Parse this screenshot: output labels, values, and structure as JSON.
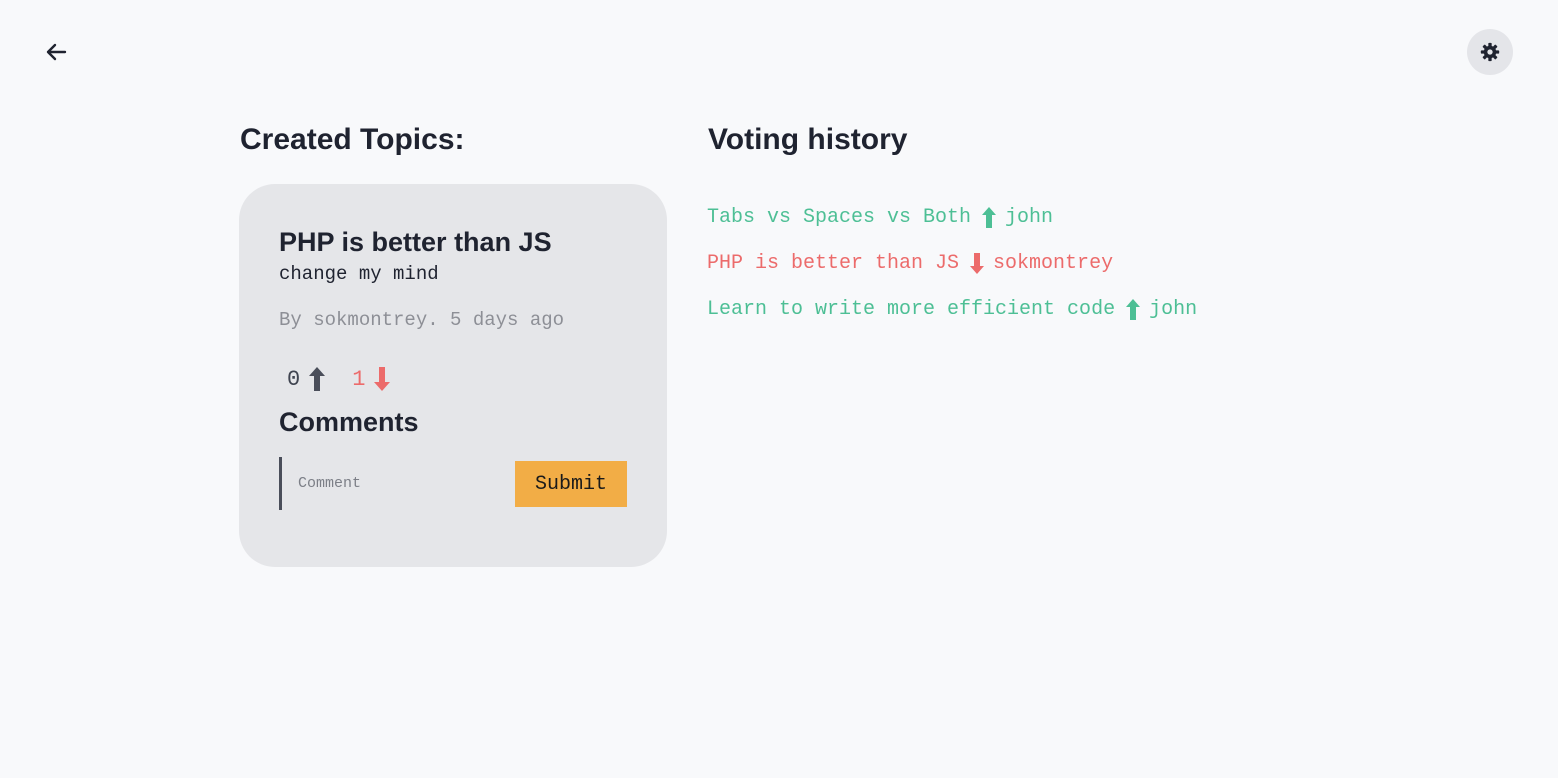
{
  "nav": {
    "back_icon": "arrow-left-icon",
    "settings_icon": "gear-icon"
  },
  "created_topics": {
    "heading": "Created Topics:",
    "topics": [
      {
        "title": "PHP is better than JS",
        "description": "change my mind",
        "meta": "By sokmontrey. 5 days ago",
        "upvotes": "0",
        "downvotes": "1",
        "comments_heading": "Comments",
        "comment_placeholder": "Comment",
        "submit_label": "Submit"
      }
    ]
  },
  "voting_history": {
    "heading": "Voting history",
    "items": [
      {
        "topic": "Tabs vs Spaces vs Both",
        "direction": "up",
        "user": "john",
        "color": "#4dbf95"
      },
      {
        "topic": "PHP is better than JS",
        "direction": "down",
        "user": "sokmontrey",
        "color": "#ec6b6b"
      },
      {
        "topic": "Learn to write more efficient code",
        "direction": "up",
        "user": "john",
        "color": "#4dbf95"
      }
    ]
  },
  "colors": {
    "upvote": "#4dbf95",
    "downvote": "#ec6b6b",
    "accent_button": "#f2ad46",
    "card_bg": "#e5e6e9"
  }
}
